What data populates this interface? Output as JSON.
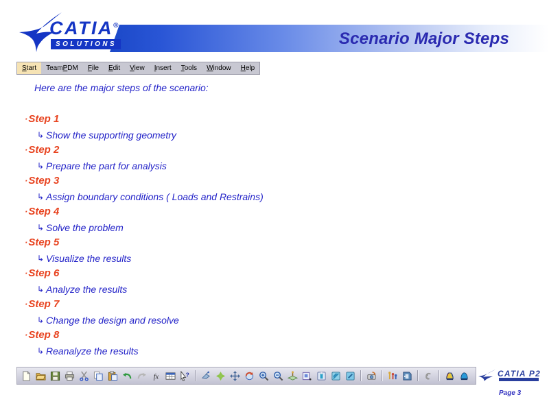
{
  "header": {
    "logo_text": "CATIA",
    "logo_reg": "®",
    "logo_sub": "SOLUTIONS",
    "title": "Scenario Major Steps"
  },
  "menubar": {
    "items": [
      {
        "label": "Start",
        "mnemonic": "S",
        "active": true
      },
      {
        "label": "TeamPDM",
        "mnemonic": "P",
        "active": false
      },
      {
        "label": "File",
        "mnemonic": "F",
        "active": false
      },
      {
        "label": "Edit",
        "mnemonic": "E",
        "active": false
      },
      {
        "label": "View",
        "mnemonic": "V",
        "active": false
      },
      {
        "label": "Insert",
        "mnemonic": "I",
        "active": false
      },
      {
        "label": "Tools",
        "mnemonic": "T",
        "active": false
      },
      {
        "label": "Window",
        "mnemonic": "W",
        "active": false
      },
      {
        "label": "Help",
        "mnemonic": "H",
        "active": false
      }
    ]
  },
  "content": {
    "intro": "Here are the major steps of the scenario:",
    "bullet_char": "·",
    "sub_glyph": "↳",
    "steps": [
      {
        "title": "Step 1",
        "detail": "Show the supporting geometry"
      },
      {
        "title": "Step 2",
        "detail": "Prepare the part for analysis"
      },
      {
        "title": "Step 3",
        "detail": "Assign boundary conditions ( Loads and Restrains)"
      },
      {
        "title": "Step 4",
        "detail": "Solve the problem"
      },
      {
        "title": "Step 5",
        "detail": "Visualize  the results"
      },
      {
        "title": "Step 6",
        "detail": "Analyze the results"
      },
      {
        "title": "Step 7",
        "detail": "Change the design and resolve"
      },
      {
        "title": "Step 8",
        "detail": "Reanalyze the results"
      }
    ]
  },
  "toolbar": {
    "groups": [
      {
        "buttons": [
          {
            "icon": "new-document-icon"
          },
          {
            "icon": "open-folder-icon"
          },
          {
            "icon": "save-disk-icon"
          },
          {
            "icon": "print-icon"
          },
          {
            "icon": "cut-scissors-icon"
          },
          {
            "icon": "copy-icon"
          },
          {
            "icon": "paste-icon"
          },
          {
            "icon": "undo-arrow-icon"
          },
          {
            "icon": "redo-arrow-icon"
          },
          {
            "icon": "formula-fx-icon"
          },
          {
            "icon": "table-grid-icon"
          },
          {
            "icon": "help-pointer-icon"
          }
        ]
      },
      {
        "buttons": [
          {
            "icon": "fly-through-icon"
          },
          {
            "icon": "fit-all-in-icon"
          },
          {
            "icon": "pan-move-icon"
          },
          {
            "icon": "rotate-icon"
          },
          {
            "icon": "zoom-in-icon"
          },
          {
            "icon": "zoom-out-icon"
          },
          {
            "icon": "normal-view-icon"
          },
          {
            "icon": "view-cube-icon"
          },
          {
            "icon": "shading-icon"
          },
          {
            "icon": "render-style-icon"
          },
          {
            "icon": "apply-material-icon"
          }
        ]
      },
      {
        "buttons": [
          {
            "icon": "camera-icon"
          }
        ]
      },
      {
        "buttons": [
          {
            "icon": "measure-icon"
          },
          {
            "icon": "analysis-icon"
          }
        ]
      },
      {
        "buttons": [
          {
            "icon": "spiral-swirl-icon"
          }
        ]
      },
      {
        "buttons": [
          {
            "icon": "mesh-part-icon"
          },
          {
            "icon": "mesh-part-blue-icon"
          }
        ]
      }
    ]
  },
  "footer": {
    "p2_text": "CATIA P2",
    "page": "Page 3"
  }
}
